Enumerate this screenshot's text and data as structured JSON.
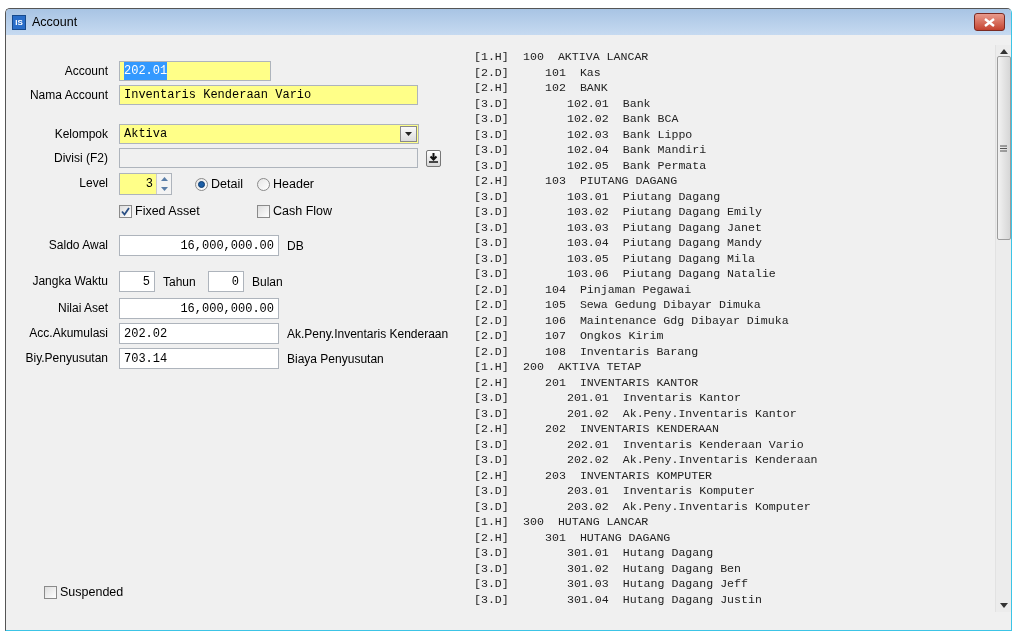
{
  "window": {
    "title": "Account",
    "icon_label": "IS"
  },
  "form": {
    "account": {
      "label": "Account",
      "value": "202.01",
      "text_selected": true
    },
    "nama_account": {
      "label": "Nama Account",
      "value": "Inventaris Kenderaan Vario"
    },
    "kelompok": {
      "label": "Kelompok",
      "value": "Aktiva"
    },
    "divisi": {
      "label": "Divisi (F2)",
      "disabled": true
    },
    "level": {
      "label": "Level",
      "value": "3"
    },
    "level_type": [
      {
        "label": "Detail",
        "selected": true
      },
      {
        "label": "Header",
        "selected": false
      }
    ],
    "flags": [
      {
        "label": "Fixed Asset",
        "checked": true
      },
      {
        "label": "Cash Flow",
        "checked": false
      }
    ],
    "saldo_awal": {
      "label": "Saldo Awal",
      "value": "16,000,000.00",
      "suffix": "DB"
    },
    "jangka_waktu": {
      "label": "Jangka Waktu",
      "years": "5",
      "years_unit": "Tahun",
      "months": "0",
      "months_unit": "Bulan"
    },
    "nilai_aset": {
      "label": "Nilai Aset",
      "value": "16,000,000.00"
    },
    "acc_akumulasi": {
      "label": "Acc.Akumulasi",
      "value": "202.02",
      "description": "Ak.Peny.Inventaris Kenderaan"
    },
    "biy_penyusutan": {
      "label": "Biy.Penyusutan",
      "value": "703.14",
      "description": "Biaya Penyusutan"
    },
    "suspended": {
      "label": "Suspended",
      "checked": false
    }
  },
  "account_list": [
    {
      "tag": "[1.H]",
      "code": "100",
      "name": "AKTIVA LANCAR",
      "children": [
        {
          "tag": "[2.D]",
          "code": "101",
          "name": "Kas"
        },
        {
          "tag": "[2.H]",
          "code": "102",
          "name": "BANK",
          "children": [
            {
              "tag": "[3.D]",
              "code": "102.01",
              "name": "Bank"
            },
            {
              "tag": "[3.D]",
              "code": "102.02",
              "name": "Bank BCA"
            },
            {
              "tag": "[3.D]",
              "code": "102.03",
              "name": "Bank Lippo"
            },
            {
              "tag": "[3.D]",
              "code": "102.04",
              "name": "Bank Mandiri"
            },
            {
              "tag": "[3.D]",
              "code": "102.05",
              "name": "Bank Permata"
            }
          ]
        },
        {
          "tag": "[2.H]",
          "code": "103",
          "name": "PIUTANG DAGANG",
          "children": [
            {
              "tag": "[3.D]",
              "code": "103.01",
              "name": "Piutang Dagang"
            },
            {
              "tag": "[3.D]",
              "code": "103.02",
              "name": "Piutang Dagang Emily"
            },
            {
              "tag": "[3.D]",
              "code": "103.03",
              "name": "Piutang Dagang Janet"
            },
            {
              "tag": "[3.D]",
              "code": "103.04",
              "name": "Piutang Dagang Mandy"
            },
            {
              "tag": "[3.D]",
              "code": "103.05",
              "name": "Piutang Dagang Mila"
            },
            {
              "tag": "[3.D]",
              "code": "103.06",
              "name": "Piutang Dagang Natalie"
            }
          ]
        },
        {
          "tag": "[2.D]",
          "code": "104",
          "name": "Pinjaman Pegawai"
        },
        {
          "tag": "[2.D]",
          "code": "105",
          "name": "Sewa Gedung Dibayar Dimuka"
        },
        {
          "tag": "[2.D]",
          "code": "106",
          "name": "Maintenance Gdg Dibayar Dimuka"
        },
        {
          "tag": "[2.D]",
          "code": "107",
          "name": "Ongkos Kirim"
        },
        {
          "tag": "[2.D]",
          "code": "108",
          "name": "Inventaris Barang"
        }
      ]
    },
    {
      "tag": "[1.H]",
      "code": "200",
      "name": "AKTIVA TETAP",
      "children": [
        {
          "tag": "[2.H]",
          "code": "201",
          "name": "INVENTARIS KANTOR",
          "children": [
            {
              "tag": "[3.D]",
              "code": "201.01",
              "name": "Inventaris Kantor"
            },
            {
              "tag": "[3.D]",
              "code": "201.02",
              "name": "Ak.Peny.Inventaris Kantor"
            }
          ]
        },
        {
          "tag": "[2.H]",
          "code": "202",
          "name": "INVENTARIS KENDERAAN",
          "children": [
            {
              "tag": "[3.D]",
              "code": "202.01",
              "name": "Inventaris Kenderaan Vario"
            },
            {
              "tag": "[3.D]",
              "code": "202.02",
              "name": "Ak.Peny.Inventaris Kenderaan"
            }
          ]
        },
        {
          "tag": "[2.H]",
          "code": "203",
          "name": "INVENTARIS KOMPUTER",
          "children": [
            {
              "tag": "[3.D]",
              "code": "203.01",
              "name": "Inventaris Komputer"
            },
            {
              "tag": "[3.D]",
              "code": "203.02",
              "name": "Ak.Peny.Inventaris Komputer"
            }
          ]
        }
      ]
    },
    {
      "tag": "[1.H]",
      "code": "300",
      "name": "HUTANG LANCAR",
      "children": [
        {
          "tag": "[2.H]",
          "code": "301",
          "name": "HUTANG DAGANG",
          "children": [
            {
              "tag": "[3.D]",
              "code": "301.01",
              "name": "Hutang Dagang"
            },
            {
              "tag": "[3.D]",
              "code": "301.02",
              "name": "Hutang Dagang Ben"
            },
            {
              "tag": "[3.D]",
              "code": "301.03",
              "name": "Hutang Dagang Jeff"
            },
            {
              "tag": "[3.D]",
              "code": "301.04",
              "name": "Hutang Dagang Justin"
            }
          ]
        }
      ]
    }
  ]
}
